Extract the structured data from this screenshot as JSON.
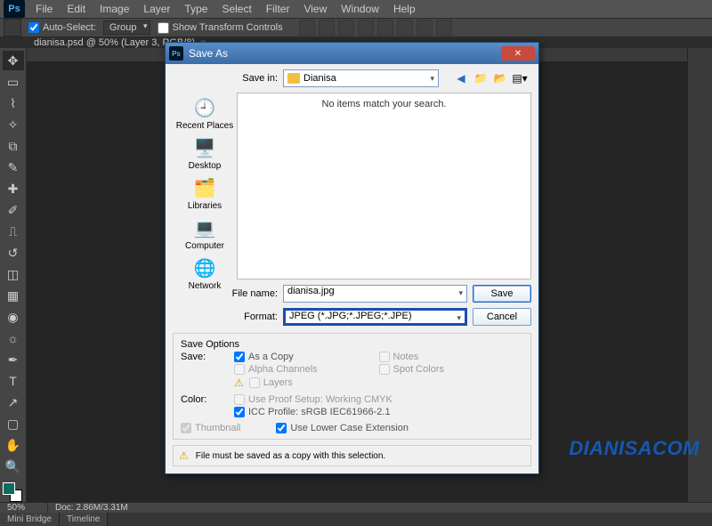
{
  "menubar": {
    "items": [
      "File",
      "Edit",
      "Image",
      "Layer",
      "Type",
      "Select",
      "Filter",
      "View",
      "Window",
      "Help"
    ]
  },
  "options_bar": {
    "auto_select_label": "Auto-Select:",
    "group_label": "Group",
    "show_transform_label": "Show Transform Controls"
  },
  "doc_tab": {
    "title": "dianisa.psd @ 50% (Layer 3, RGB/8)"
  },
  "statusbar": {
    "zoom": "50%",
    "doc": "Doc: 2.86M/3.31M"
  },
  "bottom_tabs": {
    "a": "Mini Bridge",
    "b": "Timeline"
  },
  "dialog": {
    "title": "Save As",
    "save_in_label": "Save in:",
    "save_in_value": "Dianisa",
    "no_items": "No items match your search.",
    "places": {
      "recent": "Recent Places",
      "desktop": "Desktop",
      "libraries": "Libraries",
      "computer": "Computer",
      "network": "Network"
    },
    "file_name_label": "File name:",
    "file_name_value": "dianisa.jpg",
    "format_label": "Format:",
    "format_value": "JPEG (*.JPG;*.JPEG;*.JPE)",
    "save_btn": "Save",
    "cancel_btn": "Cancel",
    "save_options_title": "Save Options",
    "save_label": "Save:",
    "as_copy": "As a Copy",
    "notes": "Notes",
    "alpha": "Alpha Channels",
    "spot": "Spot Colors",
    "layers": "Layers",
    "color_label": "Color:",
    "proof": "Use Proof Setup:  Working CMYK",
    "icc": "ICC Profile:  sRGB IEC61966-2.1",
    "thumbnail": "Thumbnail",
    "lowercase": "Use Lower Case Extension",
    "warn_msg": "File must be saved as a copy with this selection."
  },
  "watermark": "DIANISACOM"
}
